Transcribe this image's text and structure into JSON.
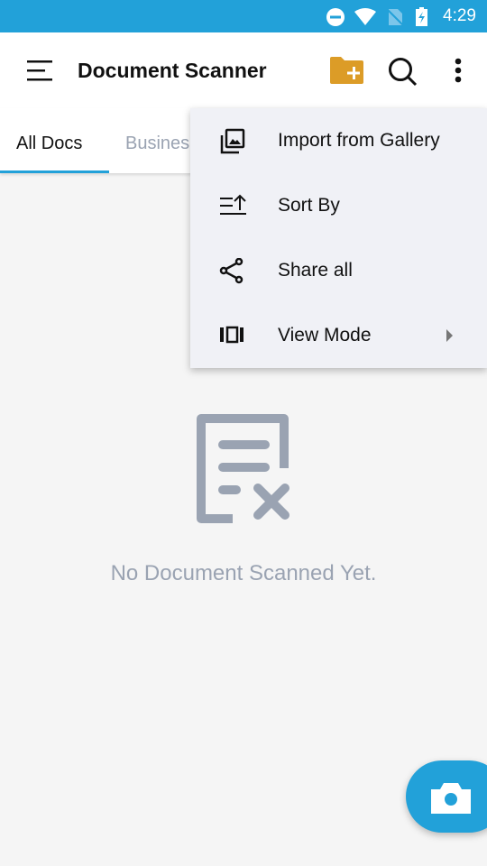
{
  "status_bar": {
    "time": "4:29",
    "icons": [
      "dnd-icon",
      "wifi-icon",
      "no-sim-icon",
      "battery-charging-icon"
    ]
  },
  "app_bar": {
    "title": "Document Scanner",
    "actions": [
      "menu-icon",
      "add-folder-icon",
      "search-icon",
      "more-vert-icon"
    ]
  },
  "tabs": [
    {
      "label": "All Docs",
      "active": true
    },
    {
      "label": "Busines",
      "active": false
    }
  ],
  "menu": {
    "items": [
      {
        "label": "Import from Gallery",
        "icon": "gallery-icon"
      },
      {
        "label": "Sort By",
        "icon": "sort-icon"
      },
      {
        "label": "Share all",
        "icon": "share-icon"
      },
      {
        "label": "View Mode",
        "icon": "view-mode-icon",
        "submenu": true
      }
    ]
  },
  "empty_state": {
    "message": "No Document Scanned Yet.",
    "icon": "no-document-icon"
  },
  "fab": {
    "icon": "camera-icon"
  },
  "colors": {
    "accent": "#22a1d9",
    "folder": "#dc9c27",
    "muted": "#9aa3b2"
  }
}
